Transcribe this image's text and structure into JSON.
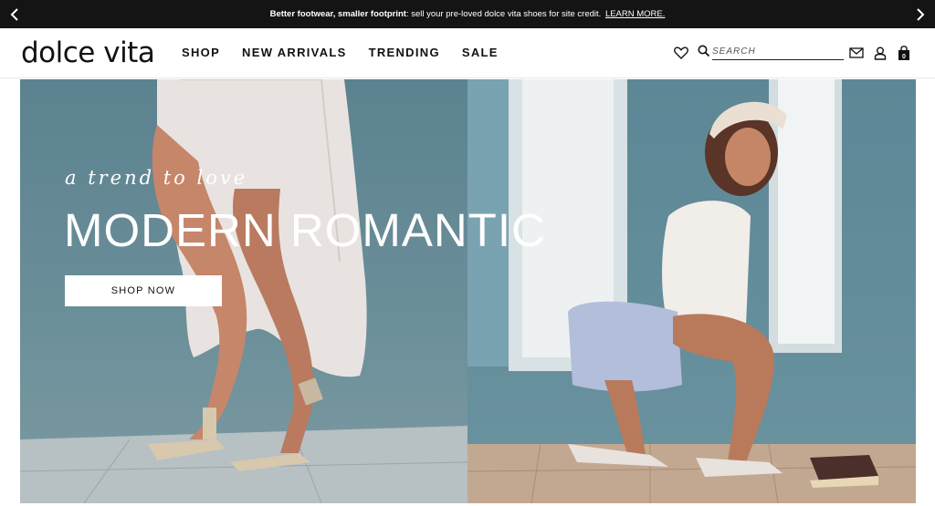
{
  "announcement": {
    "bold": "Better footwear, smaller footprint",
    "text": ": sell your pre-loved dolce vita shoes for site credit.",
    "link": "LEARN MORE."
  },
  "header": {
    "logo": "dolce vita",
    "nav": [
      "SHOP",
      "NEW ARRIVALS",
      "TRENDING",
      "SALE"
    ],
    "search_placeholder": "SEARCH",
    "cart_count": "0"
  },
  "hero": {
    "tagline": "a trend to love",
    "headline": "MODERN ROMANTIC",
    "button": "SHOP NOW"
  },
  "icons": {
    "prev": "chevron-left-icon",
    "next": "chevron-right-icon",
    "wishlist": "heart-icon",
    "search": "search-icon",
    "mail": "mail-icon",
    "account": "user-icon",
    "cart": "bag-icon"
  },
  "colors": {
    "announcement_bg": "#141414",
    "hero_bg": "#5f8590",
    "text": "#111111"
  }
}
